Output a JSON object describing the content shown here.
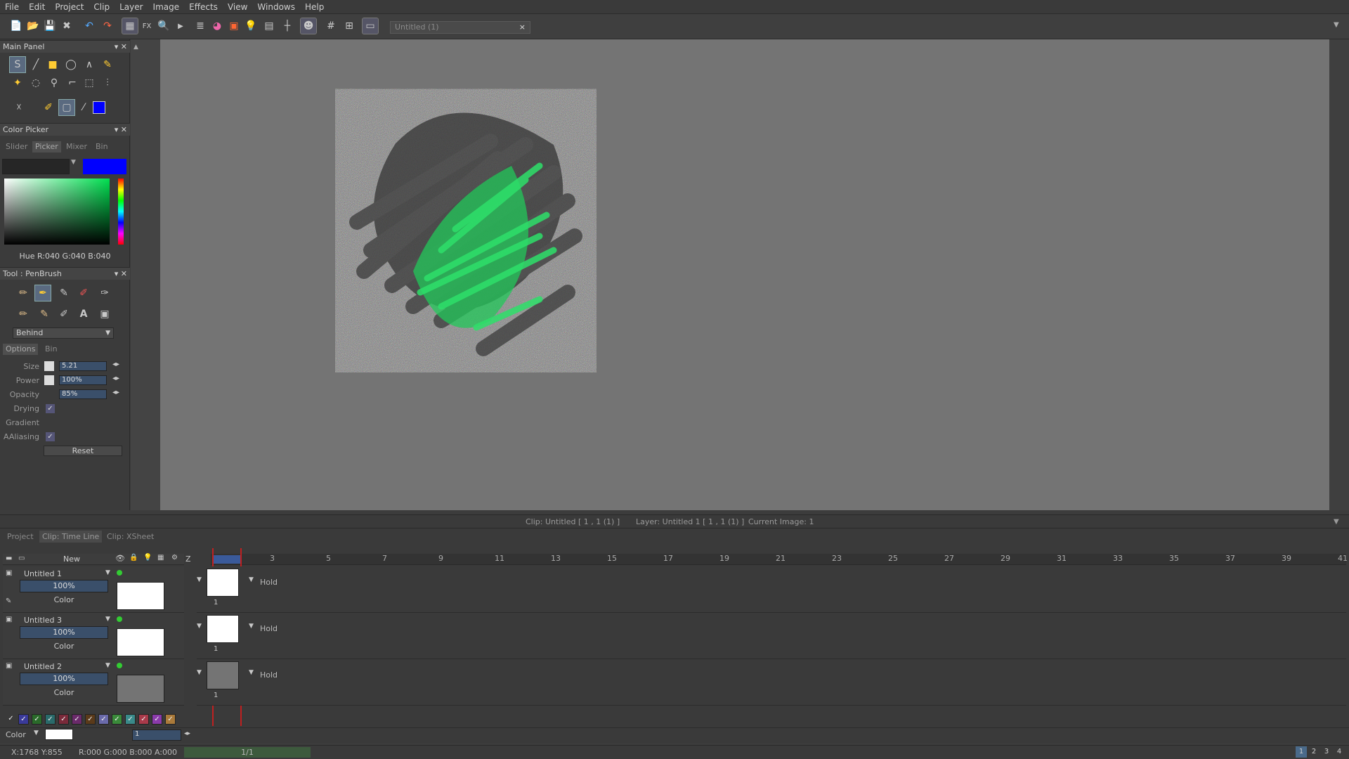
{
  "menu": [
    "File",
    "Edit",
    "Project",
    "Clip",
    "Layer",
    "Image",
    "Effects",
    "View",
    "Windows",
    "Help"
  ],
  "document_tab": {
    "title": "Untitled (1)",
    "close": "×"
  },
  "main_panel": {
    "title": "Main Panel"
  },
  "color_picker": {
    "title": "Color Picker",
    "tabs": [
      "Slider",
      "Picker",
      "Mixer",
      "Bin"
    ],
    "active_tab": "Picker",
    "current_color": "#0000ff",
    "readout": "Hue R:040 G:040 B:040"
  },
  "tool_panel": {
    "title": "Tool : PenBrush",
    "mode": "Behind",
    "tabs": [
      "Options",
      "Bin"
    ],
    "active_tab": "Options",
    "size_label": "Size",
    "size_value": "5.21",
    "power_label": "Power",
    "power_value": "100%",
    "opacity_label": "Opacity",
    "opacity_value": "85%",
    "drying_label": "Drying",
    "gradient_label": "Gradient",
    "aaliasing_label": "AAliasing",
    "reset_label": "Reset"
  },
  "status_top": {
    "clip": "Clip: Untitled [ 1 , 1  (1) ]",
    "layer": "Layer: Untitled 1 [ 1 , 1  (1) ]",
    "current_image": "Current Image: 1"
  },
  "bottom_tabs": [
    "Project",
    "Clip: Time Line",
    "Clip: XSheet"
  ],
  "bottom_active_tab": "Clip: Time Line",
  "layers_header": {
    "new_label": "New",
    "z_label": "Z"
  },
  "layers": [
    {
      "name": "Untitled 1",
      "opacity": "100%",
      "mode": "Color",
      "frame": "1",
      "hold": "Hold"
    },
    {
      "name": "Untitled 3",
      "opacity": "100%",
      "mode": "Color",
      "frame": "1",
      "hold": "Hold"
    },
    {
      "name": "Untitled 2",
      "opacity": "100%",
      "mode": "Color",
      "frame": "1",
      "hold": "Hold"
    }
  ],
  "ruler_ticks": [
    "1",
    "3",
    "5",
    "7",
    "9",
    "11",
    "13",
    "15",
    "17",
    "19",
    "21",
    "23",
    "25",
    "27",
    "29",
    "31",
    "33",
    "35",
    "37",
    "39",
    "41"
  ],
  "color_tags": [
    "#3a3a9a",
    "#2a6a2a",
    "#2a6a6a",
    "#7a2a3a",
    "#6a2a6a",
    "#5a3a1a",
    "#6a6aaa",
    "#3a8a3a",
    "#3a8a8a",
    "#a83a4a",
    "#8a3aaa",
    "#aa7a3a"
  ],
  "footer": {
    "color_label": "Color",
    "frame_value": "1"
  },
  "status_bottom": {
    "coords": "X:1768  Y:855",
    "rgba": "R:000 G:000 B:000 A:000",
    "page": "1/1",
    "pages": [
      "1",
      "2",
      "3",
      "4"
    ]
  }
}
